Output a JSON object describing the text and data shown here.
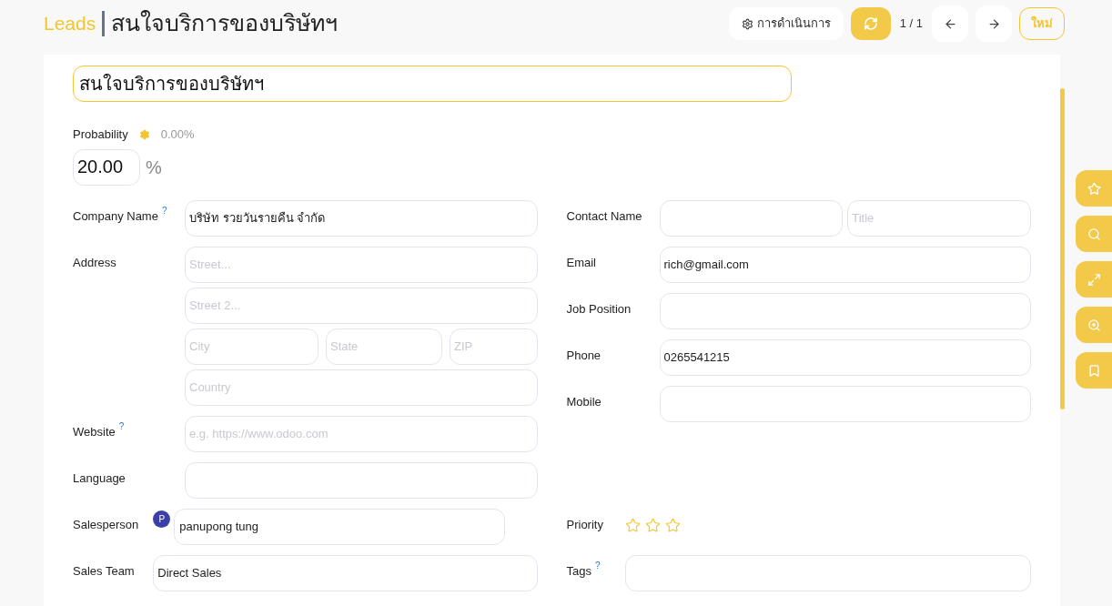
{
  "header": {
    "breadcrumb": "Leads",
    "title": "สนใจบริการของบริษัทฯ"
  },
  "toolbar": {
    "actions": "การดำเนินการ",
    "pager": "1 / 1",
    "new": "ใหม่"
  },
  "form": {
    "name": "สนใจบริการของบริษัทฯ",
    "probability": {
      "label": "Probability",
      "auto": "0.00%",
      "value": "20.00",
      "unit": "%"
    },
    "groups": [
      {
        "left": [
          {
            "kind": "text",
            "label": "Company Name",
            "help": "?",
            "value": "บริษัท รวยวันรายคืน จำกัด"
          },
          {
            "kind": "address",
            "label": "Address",
            "street": {
              "placeholder": "Street..."
            },
            "street2": {
              "placeholder": "Street 2..."
            },
            "city": {
              "placeholder": "City"
            },
            "state": {
              "placeholder": "State"
            },
            "zip": {
              "placeholder": "ZIP"
            },
            "country": {
              "placeholder": "Country"
            }
          },
          {
            "kind": "text",
            "label": "Website",
            "help": "?",
            "placeholder": "e.g. https://www.odoo.com"
          },
          {
            "kind": "text",
            "label": "Language"
          }
        ],
        "right": [
          {
            "kind": "contact",
            "label": "Contact Name",
            "title": {
              "placeholder": "Title"
            }
          },
          {
            "kind": "text",
            "label": "Email",
            "value": "rich@gmail.com"
          },
          {
            "kind": "text",
            "label": "Job Position"
          },
          {
            "kind": "text",
            "label": "Phone",
            "value": "0265541215"
          },
          {
            "kind": "text",
            "label": "Mobile"
          }
        ]
      },
      {
        "left": [
          {
            "kind": "user",
            "label": "Salesperson",
            "avatar": "P",
            "value": "panupong tung"
          },
          {
            "kind": "text",
            "label": "Sales Team",
            "value": "Direct Sales"
          }
        ],
        "right": [
          {
            "kind": "priority",
            "label": "Priority",
            "stars": 0
          },
          {
            "kind": "text",
            "label": "Tags",
            "help": "?"
          }
        ]
      }
    ]
  }
}
